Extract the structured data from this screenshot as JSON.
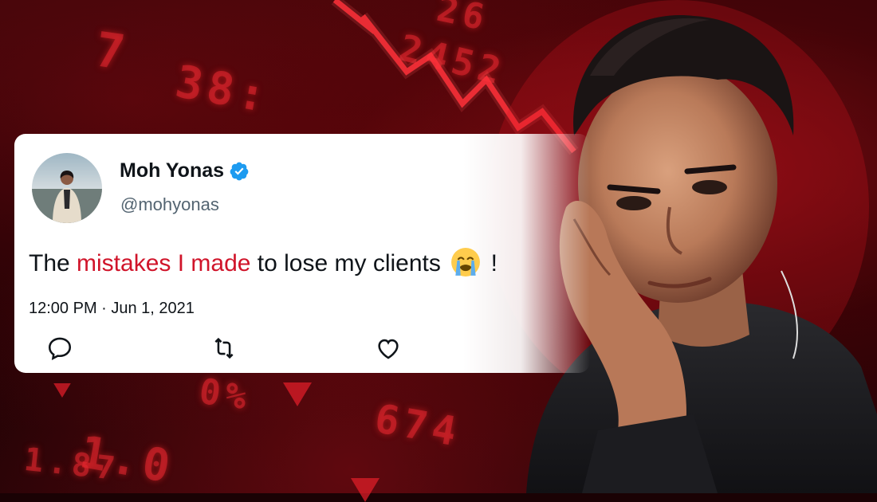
{
  "background": {
    "tickers": [
      "26",
      "2452",
      "38:",
      "7",
      "1.0",
      "674",
      "0%",
      "1.87"
    ]
  },
  "tweet": {
    "display_name": "Moh Yonas",
    "handle": "@mohyonas",
    "text_before": "The ",
    "text_highlight": "mistakes I made",
    "text_after": " to lose my clients",
    "text_end": "!",
    "emoji": "loudly-crying-face",
    "timestamp": "12:00 PM · Jun 1, 2021",
    "actions": [
      "reply-icon",
      "retweet-icon",
      "like-icon"
    ]
  },
  "colors": {
    "highlight": "#d0142a",
    "verified": "#1d9bf0",
    "text": "#0f1419",
    "muted": "#536471"
  }
}
